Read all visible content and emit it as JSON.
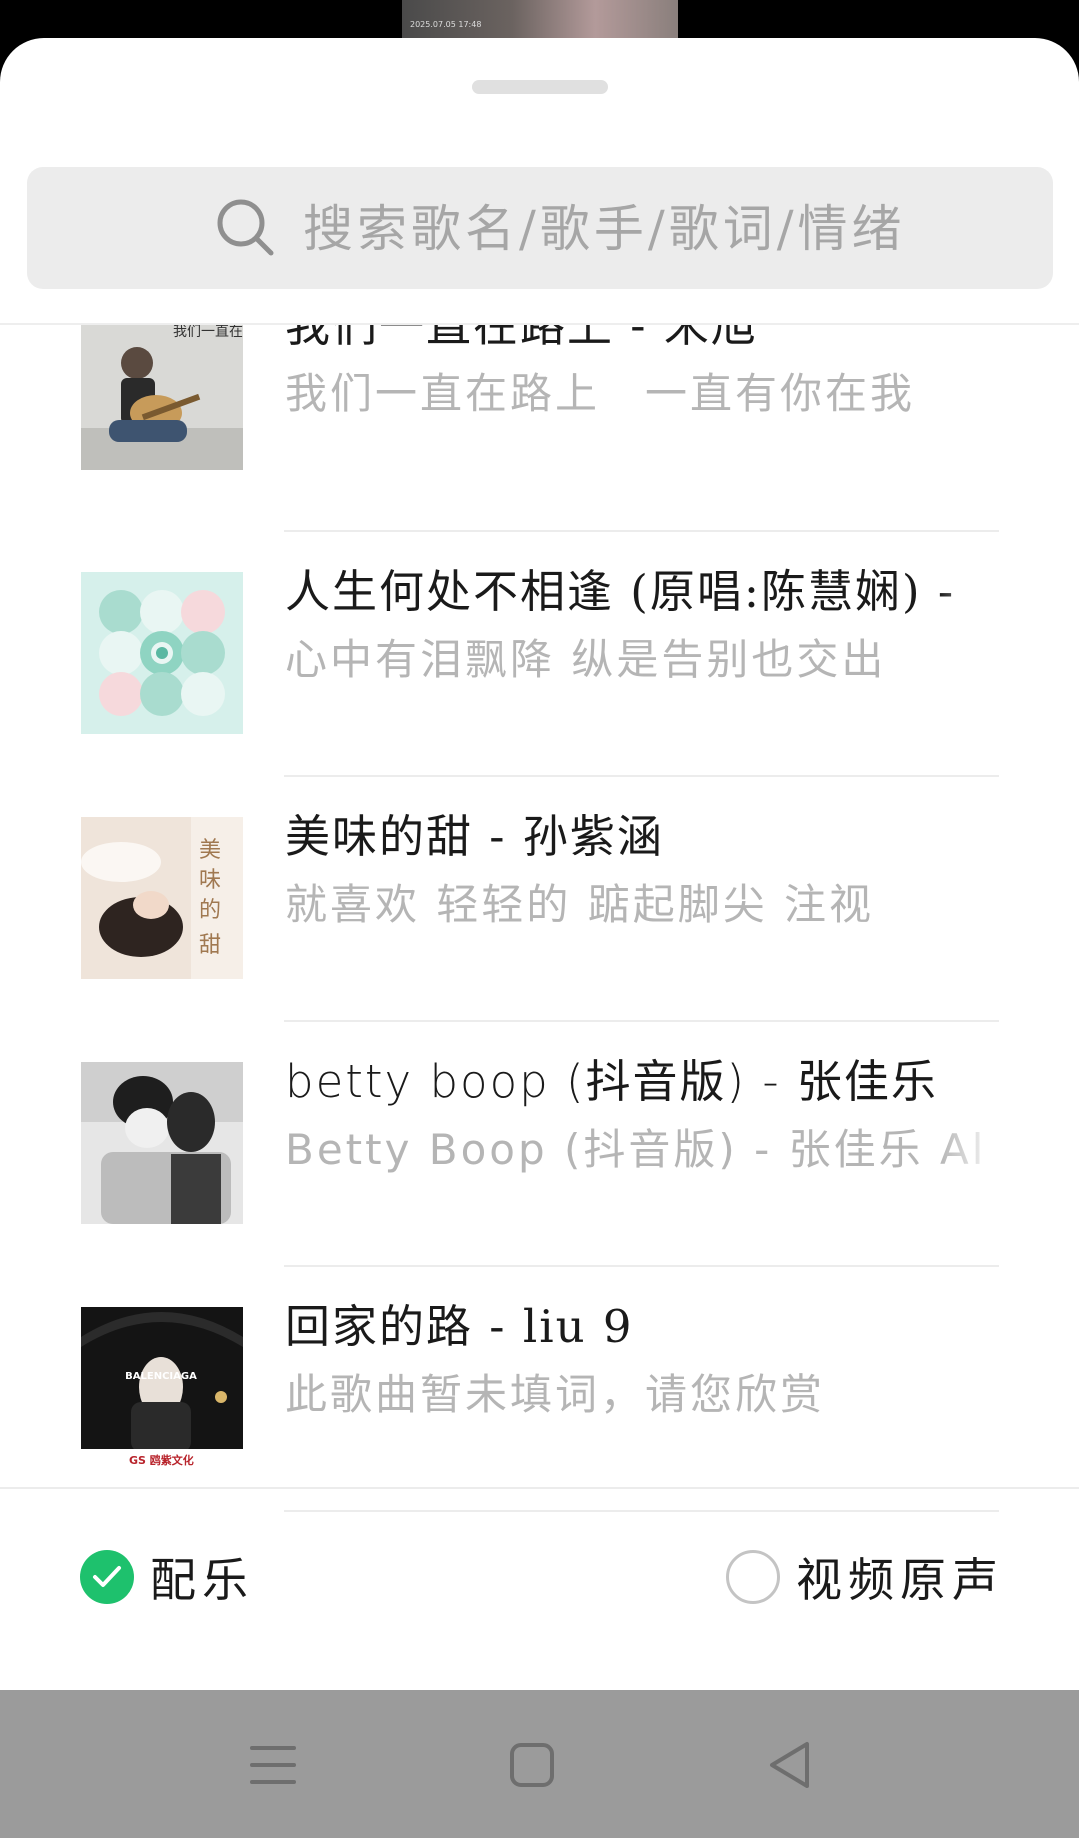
{
  "video_preview": {
    "timestamp": "2025.07.05 17:48"
  },
  "search": {
    "placeholder": "搜索歌名/歌手/歌词/情绪"
  },
  "songs": [
    {
      "title": "我们一直在路上 - 宋旭",
      "lyric": "我们一直在路上　一直有你在我",
      "cover": "guitar-singer-cover",
      "cover_text": "我们一直在路上"
    },
    {
      "title": "人生何处不相逢 (原唱:陈慧娴) -",
      "lyric": "心中有泪飘降  纵是告别也交出",
      "cover": "mint-circles-cover"
    },
    {
      "title": "美味的甜 - 孙紫涵",
      "lyric": "就喜欢  轻轻的  踮起脚尖  注视",
      "cover": "lying-girl-cover",
      "cover_text": "美味的甜"
    },
    {
      "title": "betty boop (抖音版) - 张佳乐",
      "lyric": "Betty Boop (抖音版) - 张佳乐  Al",
      "cover": "masked-couple-cover"
    },
    {
      "title": "回家的路 - liu 9",
      "lyric": "此歌曲暂未填词，请您欣赏",
      "cover": "umbrella-cover",
      "cover_text": "BALENCIAGA",
      "cover_brand": "GS 鸥紫文化"
    }
  ],
  "options": {
    "music": {
      "label": "配乐",
      "checked": true
    },
    "original": {
      "label": "视频原声",
      "checked": false
    }
  },
  "colors": {
    "accent": "#1ec16d",
    "title": "#1a1a1a",
    "lyric": "#b5b5b5",
    "navbar": "#9b9b9b"
  },
  "nav": {
    "icons": [
      "menu-icon",
      "home-square-icon",
      "back-triangle-icon"
    ]
  }
}
